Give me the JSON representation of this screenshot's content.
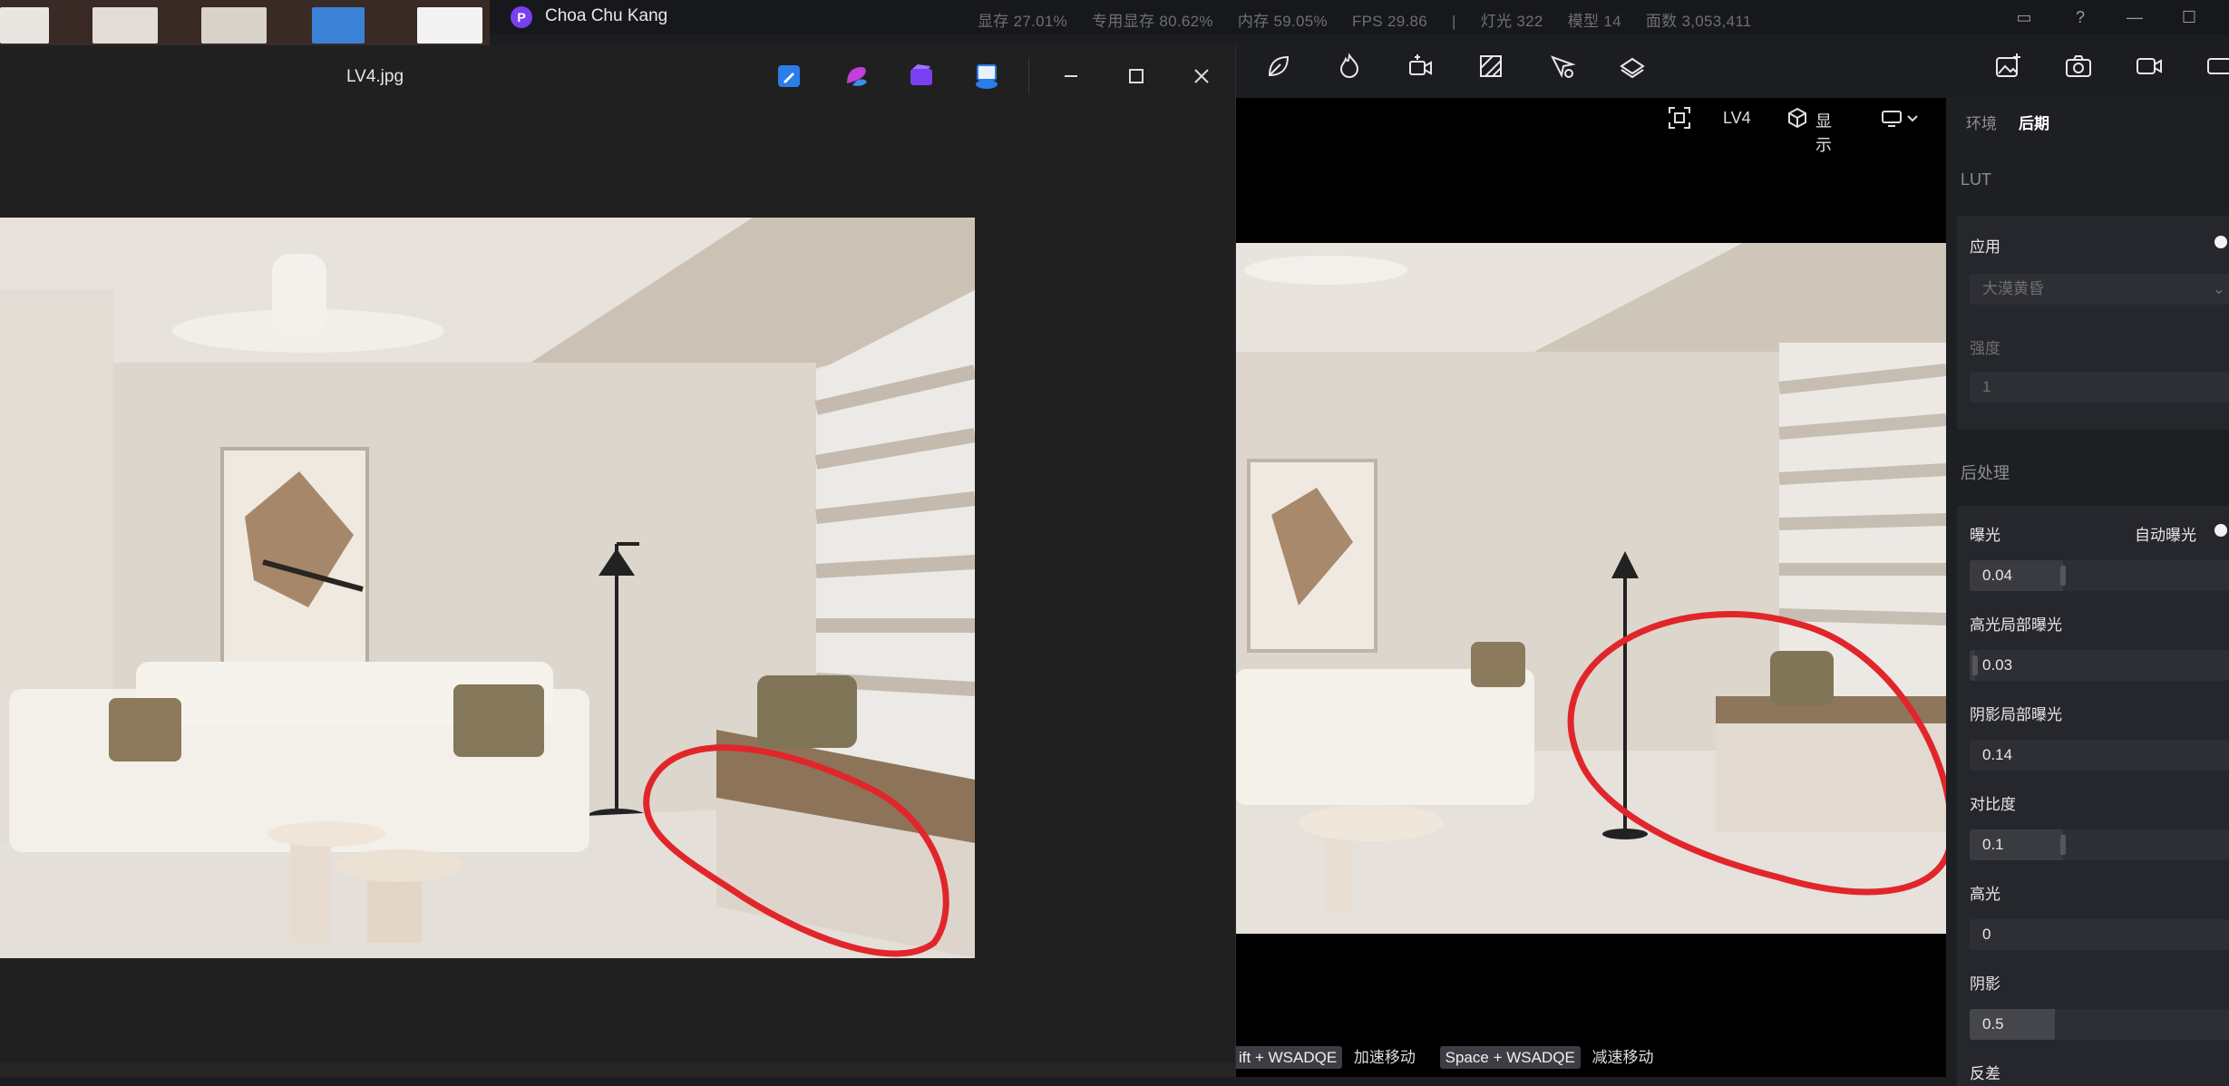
{
  "app": {
    "title": "Choa Chu Kang",
    "logo_letter": "P",
    "stats": [
      "显存 27.01%",
      "专用显存 80.62%",
      "内存 59.05%",
      "FPS 29.86",
      "|",
      "灯光 322",
      "模型 14",
      "面数 3,053,411"
    ]
  },
  "titlebar_icons": [
    "panel-icon",
    "help-icon",
    "minimize-icon",
    "maximize-icon"
  ],
  "toolbar": {
    "icons": [
      "leaf-icon",
      "fire-icon",
      "camera-move-icon",
      "texture-icon",
      "pin-icon",
      "layers-icon",
      "image-add-icon",
      "camera-icon",
      "video-icon",
      "more-icon"
    ]
  },
  "viewport": {
    "camera_label": "LV4",
    "display_label": "显示",
    "hints": [
      {
        "key": "ift + WSADQE",
        "text": "加速移动"
      },
      {
        "key": "Space + WSADQE",
        "text": "减速移动"
      }
    ]
  },
  "panel": {
    "tabs": [
      "环境",
      "后期"
    ],
    "active_tab": "后期",
    "lut": {
      "title": "LUT",
      "apply_label": "应用",
      "preset": "大漠黄昏",
      "strength_label": "强度",
      "strength_value": "1"
    },
    "post": {
      "title": "后处理",
      "auto_exposure_label": "自动曝光",
      "params": [
        {
          "label": "曝光",
          "value": "0.04",
          "level": 0.36
        },
        {
          "label": "高光局部曝光",
          "value": "0.03",
          "level": 0.02
        },
        {
          "label": "阴影局部曝光",
          "value": "0.14",
          "level": 0.0
        },
        {
          "label": "对比度",
          "value": "0.1",
          "level": 0.36
        },
        {
          "label": "高光",
          "value": "0",
          "level": 0.0
        },
        {
          "label": "阴影",
          "value": "0.5",
          "level": 0.33
        }
      ],
      "next_label": "反差"
    }
  },
  "viewer": {
    "filename": "LV4.jpg",
    "app_icons": [
      "edit-icon",
      "copilot-icon",
      "clipchamp-icon",
      "share-icon"
    ]
  },
  "colors": {
    "annotation": "#e1262b",
    "accent": "#7b3ff2"
  }
}
